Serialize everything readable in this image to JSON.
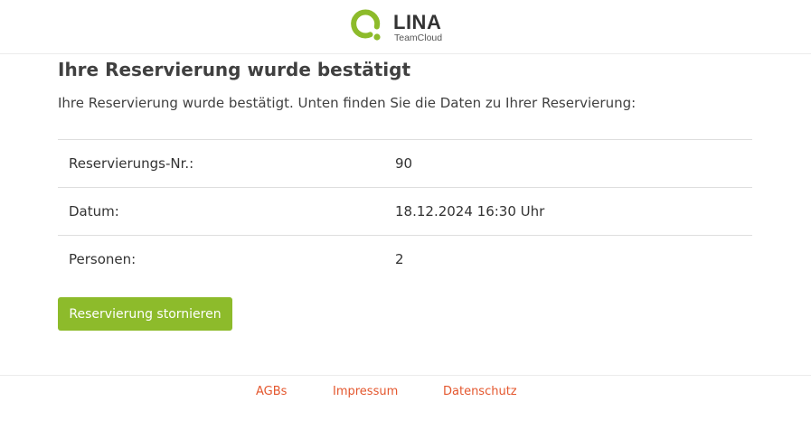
{
  "header": {
    "logo": {
      "word": "LINA",
      "sub": "TeamCloud",
      "mark_color": "#8dbb2b"
    }
  },
  "main": {
    "title": "Ihre Reservierung wurde bestätigt",
    "intro": "Ihre Reservierung wurde bestätigt. Unten finden Sie die Daten zu Ihrer Reservierung:",
    "details": [
      {
        "label": "Reservierungs-Nr.:",
        "value": "90"
      },
      {
        "label": "Datum:",
        "value": "18.12.2024 16:30 Uhr"
      },
      {
        "label": "Personen:",
        "value": "2"
      }
    ],
    "cancel_label": "Reservierung stornieren",
    "accent_color": "#8dbb2b"
  },
  "footer": {
    "links": [
      {
        "label": "AGBs"
      },
      {
        "label": "Impressum"
      },
      {
        "label": "Datenschutz"
      }
    ],
    "link_color": "#e4572e"
  }
}
